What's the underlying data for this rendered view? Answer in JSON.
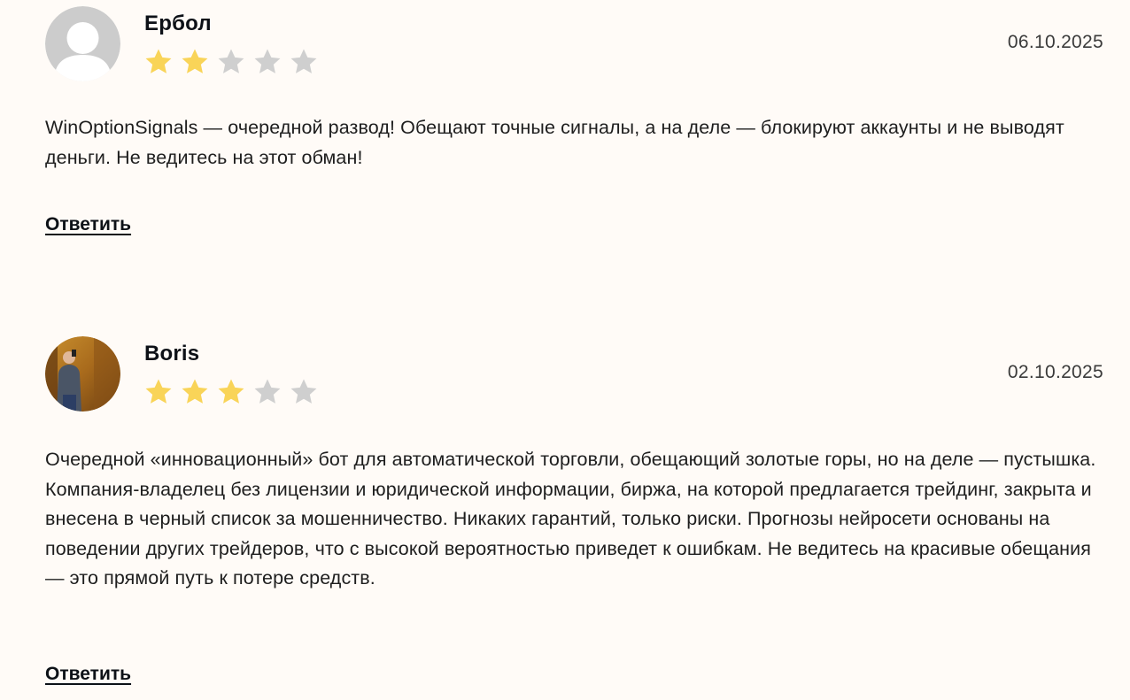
{
  "colors": {
    "background": "#fffbf7",
    "star_filled": "#f9d458",
    "star_empty": "#cfcfcf",
    "avatar_placeholder_bg": "#cccccc"
  },
  "reviews": [
    {
      "author": "Ербол",
      "rating": 2,
      "max_rating": 5,
      "date": "06.10.2025",
      "avatar": "default-user-icon",
      "text": "WinOptionSignals — очередной развод! Обещают точные сигналы, а на деле — блокируют аккаунты и не выводят деньги. Не ведитесь на этот обман!",
      "reply_label": "Ответить"
    },
    {
      "author": "Boris",
      "rating": 3,
      "max_rating": 5,
      "date": "02.10.2025",
      "avatar": "user-photo",
      "text": "Очередной «инновационный» бот для автоматической торговли, обещающий золотые горы, но на деле — пустышка. Компания-владелец без лицензии и юридической информации, биржа, на которой предлагается трейдинг, закрыта и внесена в черный список за мошенничество. Никаких гарантий, только риски. Прогнозы нейросети основаны на поведении других трейдеров, что с высокой вероятностью приведет к ошибкам. Не ведитесь на красивые обещания — это прямой путь к потере средств.",
      "reply_label": "Ответить"
    }
  ]
}
